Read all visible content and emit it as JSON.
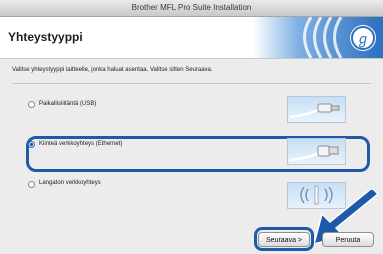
{
  "window": {
    "title": "Brother MFL Pro Suite Installation"
  },
  "header": {
    "title": "Yhteystyyppi"
  },
  "instruction": "Valitse yhteystyyppi laitteelle, jonka haluat asentaa. Valitse sitten Seuraava.",
  "options": [
    {
      "label": "Paikallisliitäntä (USB)",
      "selected": false,
      "icon": "usb-cable-icon"
    },
    {
      "label": "Kiinteä verkkoyhteys (Ethernet)",
      "selected": true,
      "icon": "ethernet-cable-icon"
    },
    {
      "label": "Langaton verkkoyhteys",
      "selected": false,
      "icon": "wireless-icon"
    }
  ],
  "buttons": {
    "next": "Seuraava >",
    "cancel": "Peruuta"
  },
  "colors": {
    "accent": "#1e5aa8",
    "brand_blue": "#2a6fbf"
  }
}
